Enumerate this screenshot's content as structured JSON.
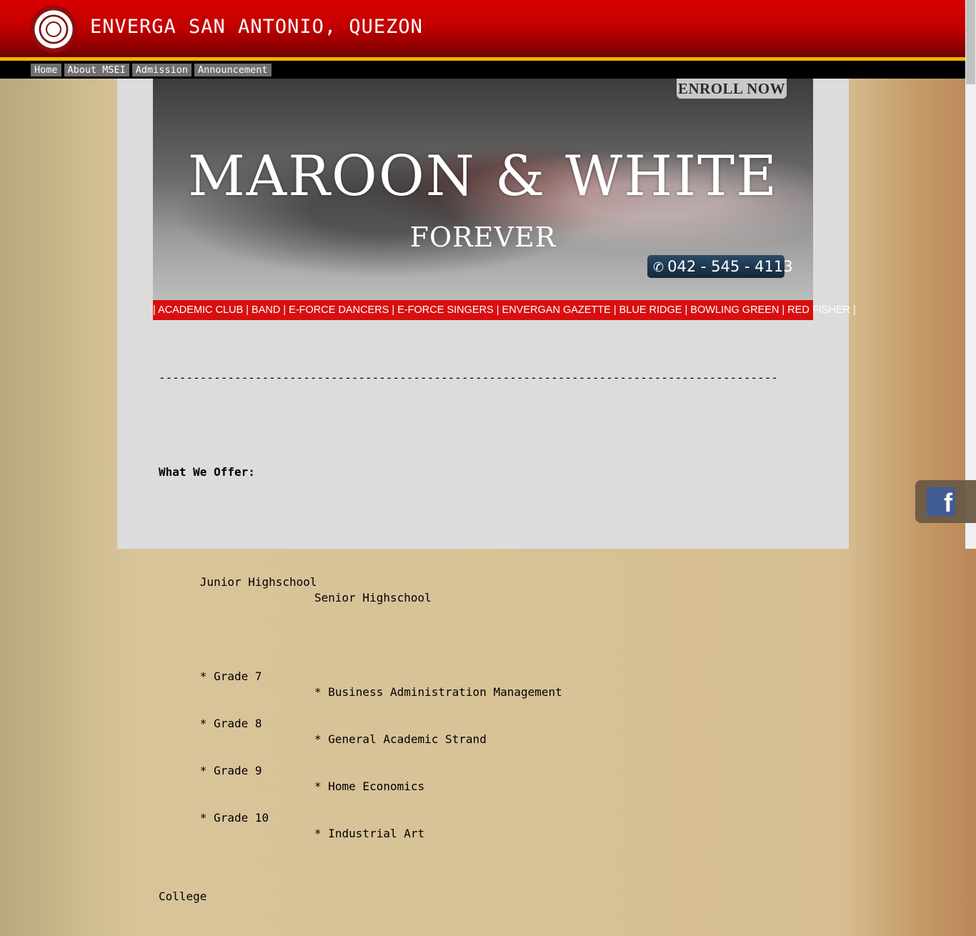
{
  "header": {
    "site_title": "ENVERGA SAN ANTONIO, QUEZON",
    "logo_icon": "school-seal-logo",
    "colors": {
      "header_red": "#c40000",
      "gold_line": "#f2b400",
      "nav_bg": "#000000"
    }
  },
  "nav": {
    "items": [
      {
        "label": "Home"
      },
      {
        "label": "About MSEI"
      },
      {
        "label": "Admission"
      },
      {
        "label": "Announcement"
      }
    ]
  },
  "banner": {
    "enroll_label": "ENROLL NOW",
    "headline": "MAROON & WHITE",
    "subline": "FOREVER",
    "phone_icon": "phone-icon",
    "phone": "042 - 545 - 4113",
    "clubs": "| ACADEMIC CLUB | BAND | E-FORCE DANCERS | E-FORCE SINGERS | ENVERGAN GAZETTE | BLUE RIDGE | BOWLING GREEN | RED FISHER |"
  },
  "content": {
    "divider": "------------------------------------------------------------------------------------------",
    "offer_heading": "What We Offer:",
    "junior_heading": "Junior Highschool",
    "senior_heading": "Senior Highschool",
    "junior_items": [
      "* Grade 7",
      "* Grade 8",
      "* Grade 9",
      "* Grade 10"
    ],
    "senior_items": [
      "* Business Administration Management",
      "* General Academic Strand",
      "* Home Economics",
      "* Industrial Art"
    ],
    "college_heading": "College"
  },
  "social": {
    "facebook_icon": "facebook-icon",
    "facebook_glyph": "f"
  }
}
